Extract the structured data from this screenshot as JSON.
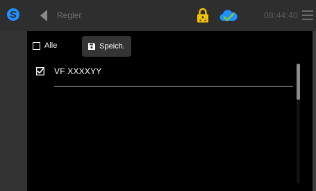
{
  "header": {
    "title": "Regler",
    "clock": "08:44:40"
  },
  "toolbar": {
    "select_all_label": "Alle",
    "save_label": "Speich."
  },
  "list": {
    "items": [
      {
        "label": "VF XXXXYY",
        "checked": true
      }
    ]
  },
  "icons": {
    "logo": "logo-icon",
    "back": "back-arrow-icon",
    "lock": "lock-icon",
    "cloud": "cloud-icon",
    "menu": "menu-icon",
    "save": "floppy-disk-icon"
  },
  "colors": {
    "accent": "#1e90ff",
    "lock": "#f2c200",
    "background": "#000000",
    "header": "#2e2e2e"
  }
}
